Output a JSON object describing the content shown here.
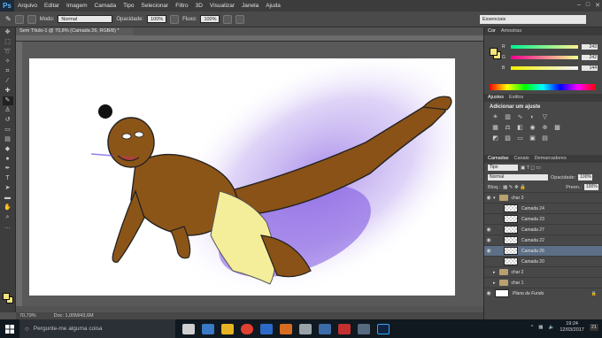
{
  "app": {
    "logo": "Ps",
    "menu": [
      "Arquivo",
      "Editar",
      "Imagem",
      "Camada",
      "Tipo",
      "Selecionar",
      "Filtro",
      "3D",
      "Visualizar",
      "Janela",
      "Ajuda"
    ]
  },
  "options": {
    "mode_label": "Modo:",
    "mode_value": "Normal",
    "opacity_label": "Opacidade:",
    "opacity_value": "100%",
    "flow_label": "Fluxo:",
    "flow_value": "100%",
    "workspace": "Essenciais"
  },
  "document": {
    "tab_title": "Sem Título-1 @ 70,8% (Camada 26, RGB/8) *",
    "zoom": "70,79%",
    "doc_info": "Doc: 1,00M/43,6M"
  },
  "color_panel": {
    "tabs": [
      "Cor",
      "Amostras"
    ],
    "channels": [
      {
        "label": "R",
        "value": "243"
      },
      {
        "label": "G",
        "value": "242"
      },
      {
        "label": "B",
        "value": "144"
      }
    ],
    "foreground": "#f2e37a"
  },
  "adjust_panel": {
    "tabs": [
      "Ajustes",
      "Estilos"
    ],
    "title": "Adicionar um ajuste"
  },
  "layers_panel": {
    "tabs": [
      "Camadas",
      "Canais",
      "Demarcadores"
    ],
    "kind_filter": "Tipo",
    "blend_mode": "Normal",
    "opacity_label": "Opacidade:",
    "opacity_value": "100%",
    "lock_label": "Bloq.:",
    "fill_label": "Preen.:",
    "fill_value": "100%",
    "layers": [
      {
        "name": "char 3",
        "type": "group",
        "visible": true,
        "selected": false,
        "indent": 0
      },
      {
        "name": "Camada 24",
        "type": "layer",
        "visible": false,
        "selected": false,
        "indent": 1
      },
      {
        "name": "Camada 23",
        "type": "layer",
        "visible": false,
        "selected": false,
        "indent": 1
      },
      {
        "name": "Camada 27",
        "type": "layer",
        "visible": true,
        "selected": false,
        "indent": 1
      },
      {
        "name": "Camada 22",
        "type": "layer",
        "visible": true,
        "selected": false,
        "indent": 1
      },
      {
        "name": "Camada 26",
        "type": "layer",
        "visible": true,
        "selected": true,
        "indent": 1
      },
      {
        "name": "Camada 20",
        "type": "layer",
        "visible": false,
        "selected": false,
        "indent": 1
      },
      {
        "name": "char 2",
        "type": "group",
        "visible": false,
        "selected": false,
        "indent": 0
      },
      {
        "name": "char 1",
        "type": "group",
        "visible": false,
        "selected": false,
        "indent": 0
      },
      {
        "name": "Plano de Fundo",
        "type": "background",
        "visible": true,
        "selected": false,
        "indent": 0
      }
    ]
  },
  "taskbar": {
    "search_placeholder": "Pergunte-me alguma coisa",
    "time": "19:24",
    "date": "12/03/2017",
    "notification_count": "21"
  }
}
